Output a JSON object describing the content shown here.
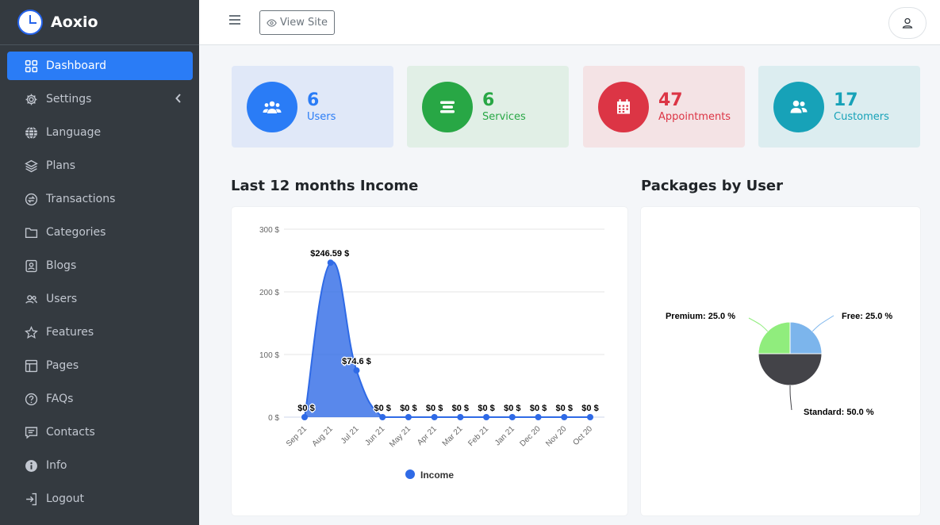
{
  "brand": {
    "name": "Aoxio"
  },
  "sidebar": {
    "items": [
      {
        "label": "Dashboard",
        "icon": "dashboard-grid-icon",
        "active": true
      },
      {
        "label": "Settings",
        "icon": "gear-icon"
      },
      {
        "label": "Language",
        "icon": "globe-icon"
      },
      {
        "label": "Plans",
        "icon": "layers-icon"
      },
      {
        "label": "Transactions",
        "icon": "exchange-icon"
      },
      {
        "label": "Categories",
        "icon": "folder-icon"
      },
      {
        "label": "Blogs",
        "icon": "blog-icon"
      },
      {
        "label": "Users",
        "icon": "users-icon"
      },
      {
        "label": "Features",
        "icon": "star-icon"
      },
      {
        "label": "Pages",
        "icon": "layout-icon"
      },
      {
        "label": "FAQs",
        "icon": "question-icon"
      },
      {
        "label": "Contacts",
        "icon": "message-icon"
      },
      {
        "label": "Info",
        "icon": "info-icon"
      },
      {
        "label": "Logout",
        "icon": "logout-icon"
      }
    ]
  },
  "topbar": {
    "view_site_label": "View Site"
  },
  "stats": [
    {
      "value": "6",
      "label": "Users",
      "color": "#2a7cf6",
      "bg": "#e0e8f8",
      "icon": "users-group-icon"
    },
    {
      "value": "6",
      "label": "Services",
      "color": "#28a745",
      "bg": "#e1efe6",
      "icon": "list-icon"
    },
    {
      "value": "47",
      "label": "Appointments",
      "color": "#dc3545",
      "bg": "#f4e3e5",
      "icon": "calendar-icon"
    },
    {
      "value": "17",
      "label": "Customers",
      "color": "#17a2b8",
      "bg": "#dcedf0",
      "icon": "customers-icon"
    }
  ],
  "income_section": {
    "title": "Last 12 months Income"
  },
  "packages_section": {
    "title": "Packages by User"
  },
  "chart_data": [
    {
      "type": "area",
      "categories": [
        "Sep 21",
        "Aug 21",
        "Jul 21",
        "Jun 21",
        "May 21",
        "Apr 21",
        "Mar 21",
        "Feb 21",
        "Jan 21",
        "Dec 20",
        "Nov 20",
        "Oct 20"
      ],
      "series": [
        {
          "name": "Income",
          "values": [
            0,
            246.59,
            74.6,
            0,
            0,
            0,
            0,
            0,
            0,
            0,
            0,
            0
          ],
          "color": "#2f6ae6"
        }
      ],
      "data_labels": [
        "$0 $",
        "$246.59 $",
        "$74.6 $",
        "$0 $",
        "$0 $",
        "$0 $",
        "$0 $",
        "$0 $",
        "$0 $",
        "$0 $",
        "$0 $",
        "$0 $"
      ],
      "y_ticks": [
        "0 $",
        "100 $",
        "200 $",
        "300 $"
      ],
      "ylim": [
        0,
        300
      ],
      "grid": true,
      "legend": "bottom"
    },
    {
      "type": "pie",
      "slices": [
        {
          "label": "Free: 25.0 %",
          "value": 25.0,
          "color": "#7cb5ec"
        },
        {
          "label": "Standard: 50.0 %",
          "value": 50.0,
          "color": "#434348"
        },
        {
          "label": "Premium: 25.0 %",
          "value": 25.0,
          "color": "#90ed7d"
        }
      ]
    }
  ]
}
